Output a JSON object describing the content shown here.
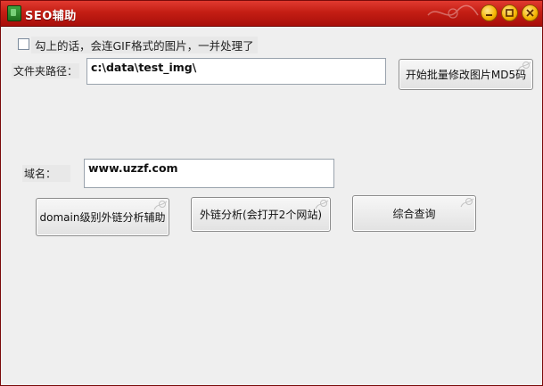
{
  "window": {
    "title": "SEO辅助"
  },
  "options": {
    "gif_checkbox_label": "勾上的话，会连GIF格式的图片，一并处理了"
  },
  "path": {
    "label": "文件夹路径：",
    "value": "c:\\data\\test_img\\"
  },
  "md5_button_label": "开始批量修改图片MD5码",
  "domain": {
    "label": "域名：",
    "value": "www.uzzf.com"
  },
  "buttons": {
    "domain_analysis": "domain级别外链分析辅助",
    "outlink_analysis": "外链分析(会打开2个网站)",
    "combined_query": "综合查询"
  }
}
